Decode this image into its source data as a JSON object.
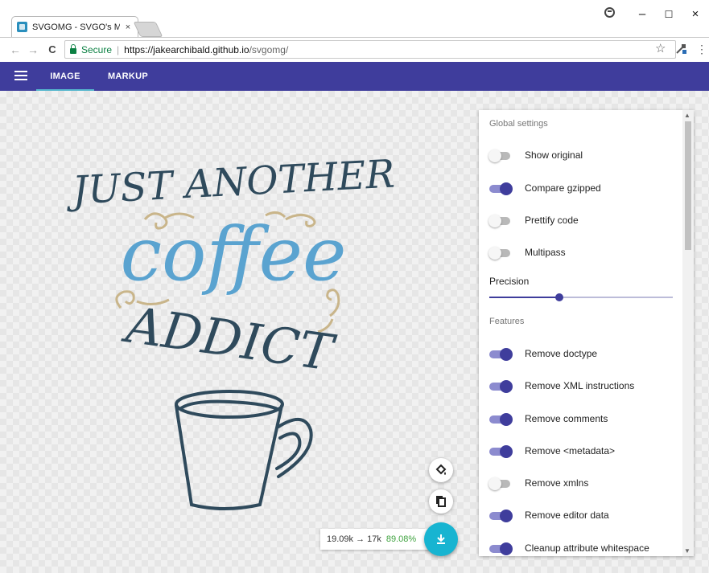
{
  "browser": {
    "tab_title": "SVGOMG - SVGO's Missi",
    "tab_close": "×",
    "back": "←",
    "forward": "→",
    "reload": "C",
    "secure_label": "Secure",
    "url_host": "https://jakearchibald.github.io",
    "url_path": "/svgomg/",
    "bookmark_star": "☆",
    "menu_dots": "⋮",
    "window_controls": {
      "minimize": "–",
      "maximize": "☐",
      "close": "×"
    }
  },
  "appbar": {
    "tabs": [
      {
        "label": "IMAGE",
        "active": true
      },
      {
        "label": "MARKUP",
        "active": false
      }
    ],
    "color": "#3f3d9c",
    "accent": "#55b6cd"
  },
  "artwork": {
    "line1": "JUST ANOTHER",
    "line2": "coffee",
    "line3": "ADDICT",
    "dark_color": "#2f4a5c",
    "blue_color": "#5aa3d0",
    "swirl_color": "#c9b58a"
  },
  "settings": {
    "global_title": "Global settings",
    "global": [
      {
        "label": "Show original",
        "on": false
      },
      {
        "label": "Compare gzipped",
        "on": true
      },
      {
        "label": "Prettify code",
        "on": false
      },
      {
        "label": "Multipass",
        "on": false
      }
    ],
    "precision_label": "Precision",
    "precision_fraction": 0.38,
    "features_title": "Features",
    "features": [
      {
        "label": "Remove doctype",
        "on": true
      },
      {
        "label": "Remove XML instructions",
        "on": true
      },
      {
        "label": "Remove comments",
        "on": true
      },
      {
        "label": "Remove <metadata>",
        "on": true
      },
      {
        "label": "Remove xmlns",
        "on": false
      },
      {
        "label": "Remove editor data",
        "on": true
      },
      {
        "label": "Cleanup attribute whitespace",
        "on": true
      }
    ]
  },
  "output": {
    "size_text": "19.09k → 17k",
    "percent": "89.08%",
    "percent_color": "#3fa33f",
    "download_color": "#17b4d1"
  }
}
